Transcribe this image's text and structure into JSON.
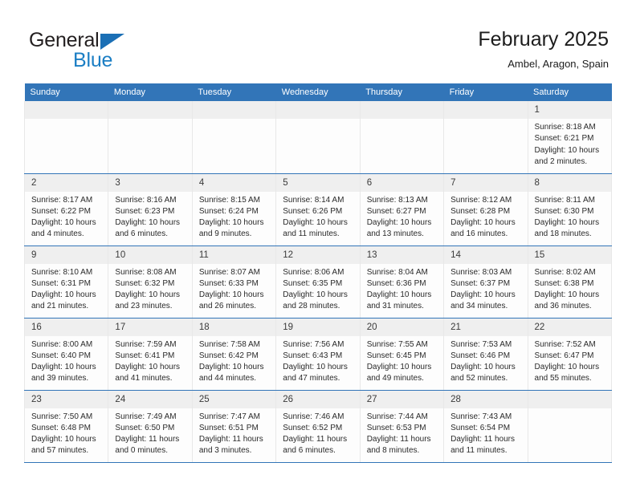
{
  "brand": {
    "name_part1": "General",
    "name_part2": "Blue",
    "logo_icon": "triangle-flag-icon"
  },
  "header": {
    "title": "February 2025",
    "location": "Ambel, Aragon, Spain"
  },
  "colors": {
    "header_blue": "#3275b8",
    "brand_blue": "#1b7ec4",
    "day_band": "#efefef",
    "cell_bg": "#fdfdfd"
  },
  "weekday_headers": [
    "Sunday",
    "Monday",
    "Tuesday",
    "Wednesday",
    "Thursday",
    "Friday",
    "Saturday"
  ],
  "weeks": [
    [
      {
        "day": "",
        "sunrise": "",
        "sunset": "",
        "daylight": "",
        "empty": true
      },
      {
        "day": "",
        "sunrise": "",
        "sunset": "",
        "daylight": "",
        "empty": true
      },
      {
        "day": "",
        "sunrise": "",
        "sunset": "",
        "daylight": "",
        "empty": true
      },
      {
        "day": "",
        "sunrise": "",
        "sunset": "",
        "daylight": "",
        "empty": true
      },
      {
        "day": "",
        "sunrise": "",
        "sunset": "",
        "daylight": "",
        "empty": true
      },
      {
        "day": "",
        "sunrise": "",
        "sunset": "",
        "daylight": "",
        "empty": true
      },
      {
        "day": "1",
        "sunrise": "Sunrise: 8:18 AM",
        "sunset": "Sunset: 6:21 PM",
        "daylight": "Daylight: 10 hours and 2 minutes."
      }
    ],
    [
      {
        "day": "2",
        "sunrise": "Sunrise: 8:17 AM",
        "sunset": "Sunset: 6:22 PM",
        "daylight": "Daylight: 10 hours and 4 minutes."
      },
      {
        "day": "3",
        "sunrise": "Sunrise: 8:16 AM",
        "sunset": "Sunset: 6:23 PM",
        "daylight": "Daylight: 10 hours and 6 minutes."
      },
      {
        "day": "4",
        "sunrise": "Sunrise: 8:15 AM",
        "sunset": "Sunset: 6:24 PM",
        "daylight": "Daylight: 10 hours and 9 minutes."
      },
      {
        "day": "5",
        "sunrise": "Sunrise: 8:14 AM",
        "sunset": "Sunset: 6:26 PM",
        "daylight": "Daylight: 10 hours and 11 minutes."
      },
      {
        "day": "6",
        "sunrise": "Sunrise: 8:13 AM",
        "sunset": "Sunset: 6:27 PM",
        "daylight": "Daylight: 10 hours and 13 minutes."
      },
      {
        "day": "7",
        "sunrise": "Sunrise: 8:12 AM",
        "sunset": "Sunset: 6:28 PM",
        "daylight": "Daylight: 10 hours and 16 minutes."
      },
      {
        "day": "8",
        "sunrise": "Sunrise: 8:11 AM",
        "sunset": "Sunset: 6:30 PM",
        "daylight": "Daylight: 10 hours and 18 minutes."
      }
    ],
    [
      {
        "day": "9",
        "sunrise": "Sunrise: 8:10 AM",
        "sunset": "Sunset: 6:31 PM",
        "daylight": "Daylight: 10 hours and 21 minutes."
      },
      {
        "day": "10",
        "sunrise": "Sunrise: 8:08 AM",
        "sunset": "Sunset: 6:32 PM",
        "daylight": "Daylight: 10 hours and 23 minutes."
      },
      {
        "day": "11",
        "sunrise": "Sunrise: 8:07 AM",
        "sunset": "Sunset: 6:33 PM",
        "daylight": "Daylight: 10 hours and 26 minutes."
      },
      {
        "day": "12",
        "sunrise": "Sunrise: 8:06 AM",
        "sunset": "Sunset: 6:35 PM",
        "daylight": "Daylight: 10 hours and 28 minutes."
      },
      {
        "day": "13",
        "sunrise": "Sunrise: 8:04 AM",
        "sunset": "Sunset: 6:36 PM",
        "daylight": "Daylight: 10 hours and 31 minutes."
      },
      {
        "day": "14",
        "sunrise": "Sunrise: 8:03 AM",
        "sunset": "Sunset: 6:37 PM",
        "daylight": "Daylight: 10 hours and 34 minutes."
      },
      {
        "day": "15",
        "sunrise": "Sunrise: 8:02 AM",
        "sunset": "Sunset: 6:38 PM",
        "daylight": "Daylight: 10 hours and 36 minutes."
      }
    ],
    [
      {
        "day": "16",
        "sunrise": "Sunrise: 8:00 AM",
        "sunset": "Sunset: 6:40 PM",
        "daylight": "Daylight: 10 hours and 39 minutes."
      },
      {
        "day": "17",
        "sunrise": "Sunrise: 7:59 AM",
        "sunset": "Sunset: 6:41 PM",
        "daylight": "Daylight: 10 hours and 41 minutes."
      },
      {
        "day": "18",
        "sunrise": "Sunrise: 7:58 AM",
        "sunset": "Sunset: 6:42 PM",
        "daylight": "Daylight: 10 hours and 44 minutes."
      },
      {
        "day": "19",
        "sunrise": "Sunrise: 7:56 AM",
        "sunset": "Sunset: 6:43 PM",
        "daylight": "Daylight: 10 hours and 47 minutes."
      },
      {
        "day": "20",
        "sunrise": "Sunrise: 7:55 AM",
        "sunset": "Sunset: 6:45 PM",
        "daylight": "Daylight: 10 hours and 49 minutes."
      },
      {
        "day": "21",
        "sunrise": "Sunrise: 7:53 AM",
        "sunset": "Sunset: 6:46 PM",
        "daylight": "Daylight: 10 hours and 52 minutes."
      },
      {
        "day": "22",
        "sunrise": "Sunrise: 7:52 AM",
        "sunset": "Sunset: 6:47 PM",
        "daylight": "Daylight: 10 hours and 55 minutes."
      }
    ],
    [
      {
        "day": "23",
        "sunrise": "Sunrise: 7:50 AM",
        "sunset": "Sunset: 6:48 PM",
        "daylight": "Daylight: 10 hours and 57 minutes."
      },
      {
        "day": "24",
        "sunrise": "Sunrise: 7:49 AM",
        "sunset": "Sunset: 6:50 PM",
        "daylight": "Daylight: 11 hours and 0 minutes."
      },
      {
        "day": "25",
        "sunrise": "Sunrise: 7:47 AM",
        "sunset": "Sunset: 6:51 PM",
        "daylight": "Daylight: 11 hours and 3 minutes."
      },
      {
        "day": "26",
        "sunrise": "Sunrise: 7:46 AM",
        "sunset": "Sunset: 6:52 PM",
        "daylight": "Daylight: 11 hours and 6 minutes."
      },
      {
        "day": "27",
        "sunrise": "Sunrise: 7:44 AM",
        "sunset": "Sunset: 6:53 PM",
        "daylight": "Daylight: 11 hours and 8 minutes."
      },
      {
        "day": "28",
        "sunrise": "Sunrise: 7:43 AM",
        "sunset": "Sunset: 6:54 PM",
        "daylight": "Daylight: 11 hours and 11 minutes."
      },
      {
        "day": "",
        "sunrise": "",
        "sunset": "",
        "daylight": "",
        "empty": true
      }
    ]
  ]
}
